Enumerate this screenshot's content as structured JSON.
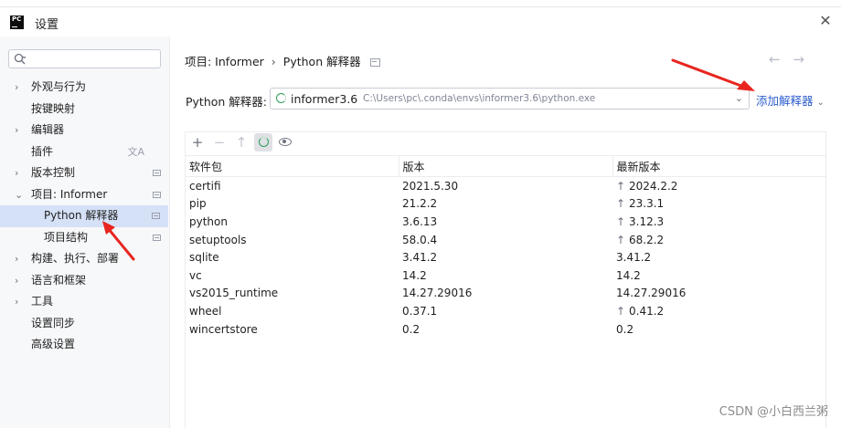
{
  "window": {
    "title": "设置",
    "logo_text": "PC"
  },
  "search": {
    "placeholder": "",
    "value": ""
  },
  "sidebar": {
    "items": [
      {
        "label": "外观与行为",
        "expandable": true
      },
      {
        "label": "按键映射",
        "expandable": false
      },
      {
        "label": "编辑器",
        "expandable": true
      },
      {
        "label": "插件",
        "expandable": false
      },
      {
        "label": "版本控制",
        "expandable": true
      },
      {
        "label": "项目: Informer",
        "expandable": true,
        "expanded": true
      },
      {
        "label": "Python 解释器",
        "selected": true,
        "child": true
      },
      {
        "label": "项目结构",
        "child": true
      },
      {
        "label": "构建、执行、部署",
        "expandable": true
      },
      {
        "label": "语言和框架",
        "expandable": true
      },
      {
        "label": "工具",
        "expandable": true
      },
      {
        "label": "设置同步",
        "expandable": false
      },
      {
        "label": "高级设置",
        "expandable": false
      }
    ]
  },
  "breadcrumb": {
    "project": "项目: Informer",
    "separator": "›",
    "page": "Python 解释器"
  },
  "interpreter": {
    "label": "Python 解释器:",
    "name": "informer3.6",
    "path": "C:\\Users\\pc\\.conda\\envs\\informer3.6\\python.exe",
    "add_label": "添加解释器"
  },
  "toolbar": {
    "add": "+",
    "remove": "−",
    "upgrade": "↑"
  },
  "packages": {
    "headers": [
      "软件包",
      "版本",
      "最新版本"
    ],
    "rows": [
      {
        "name": "certifi",
        "version": "2021.5.30",
        "latest": "2024.2.2",
        "upgrade": true
      },
      {
        "name": "pip",
        "version": "21.2.2",
        "latest": "23.3.1",
        "upgrade": true
      },
      {
        "name": "python",
        "version": "3.6.13",
        "latest": "3.12.3",
        "upgrade": true
      },
      {
        "name": "setuptools",
        "version": "58.0.4",
        "latest": "68.2.2",
        "upgrade": true
      },
      {
        "name": "sqlite",
        "version": "3.41.2",
        "latest": "3.41.2",
        "upgrade": false
      },
      {
        "name": "vc",
        "version": "14.2",
        "latest": "14.2",
        "upgrade": false
      },
      {
        "name": "vs2015_runtime",
        "version": "14.27.29016",
        "latest": "14.27.29016",
        "upgrade": false
      },
      {
        "name": "wheel",
        "version": "0.37.1",
        "latest": "0.41.2",
        "upgrade": true
      },
      {
        "name": "wincertstore",
        "version": "0.2",
        "latest": "0.2",
        "upgrade": false
      }
    ]
  },
  "watermark": "CSDN @小白西兰粥",
  "colors": {
    "accent": "#2e5fce",
    "selection": "#d5e1f7",
    "annotation_arrow": "#e8251f",
    "spinner": "#2e9c58"
  }
}
